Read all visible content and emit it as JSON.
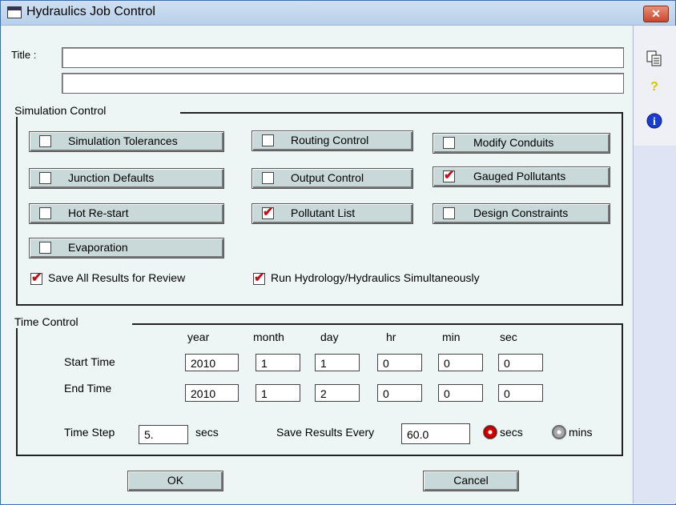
{
  "window": {
    "title": "Hydraulics Job Control",
    "close_symbol": "✕"
  },
  "title_section": {
    "label": "Title :",
    "line1": "",
    "line2": ""
  },
  "simulation_control": {
    "group_label": "Simulation Control",
    "buttons": [
      {
        "label": "Simulation Tolerances",
        "checked": false
      },
      {
        "label": "Routing Control",
        "checked": false
      },
      {
        "label": "Modify Conduits",
        "checked": false
      },
      {
        "label": "Junction Defaults",
        "checked": false
      },
      {
        "label": "Output Control",
        "checked": false
      },
      {
        "label": "Gauged Pollutants",
        "checked": true
      },
      {
        "label": "Hot Re-start",
        "checked": false
      },
      {
        "label": "Pollutant List",
        "checked": true
      },
      {
        "label": "Design Constraints",
        "checked": false
      },
      {
        "label": "Evaporation",
        "checked": false
      }
    ],
    "save_all": {
      "label": "Save All Results for Review",
      "checked": true
    },
    "run_simultaneously": {
      "label": "Run Hydrology/Hydraulics Simultaneously",
      "checked": true
    }
  },
  "time_control": {
    "group_label": "Time Control",
    "columns": [
      "year",
      "month",
      "day",
      "hr",
      "min",
      "sec"
    ],
    "start_label": "Start Time",
    "end_label": "End Time",
    "start": [
      "2010",
      "1",
      "1",
      "0",
      "0",
      "0"
    ],
    "end": [
      "2010",
      "1",
      "2",
      "0",
      "0",
      "0"
    ],
    "time_step_label": "Time Step",
    "time_step_value": "5.",
    "time_step_unit": "secs",
    "save_every_label": "Save Results Every",
    "save_every_value": "60.0",
    "unit_secs": "secs",
    "unit_mins": "mins",
    "unit_selected": "secs"
  },
  "actions": {
    "ok": "OK",
    "cancel": "Cancel"
  },
  "sidebar": {
    "copy_icon": "copy-icon",
    "help_glyph": "?",
    "info_glyph": "i"
  }
}
